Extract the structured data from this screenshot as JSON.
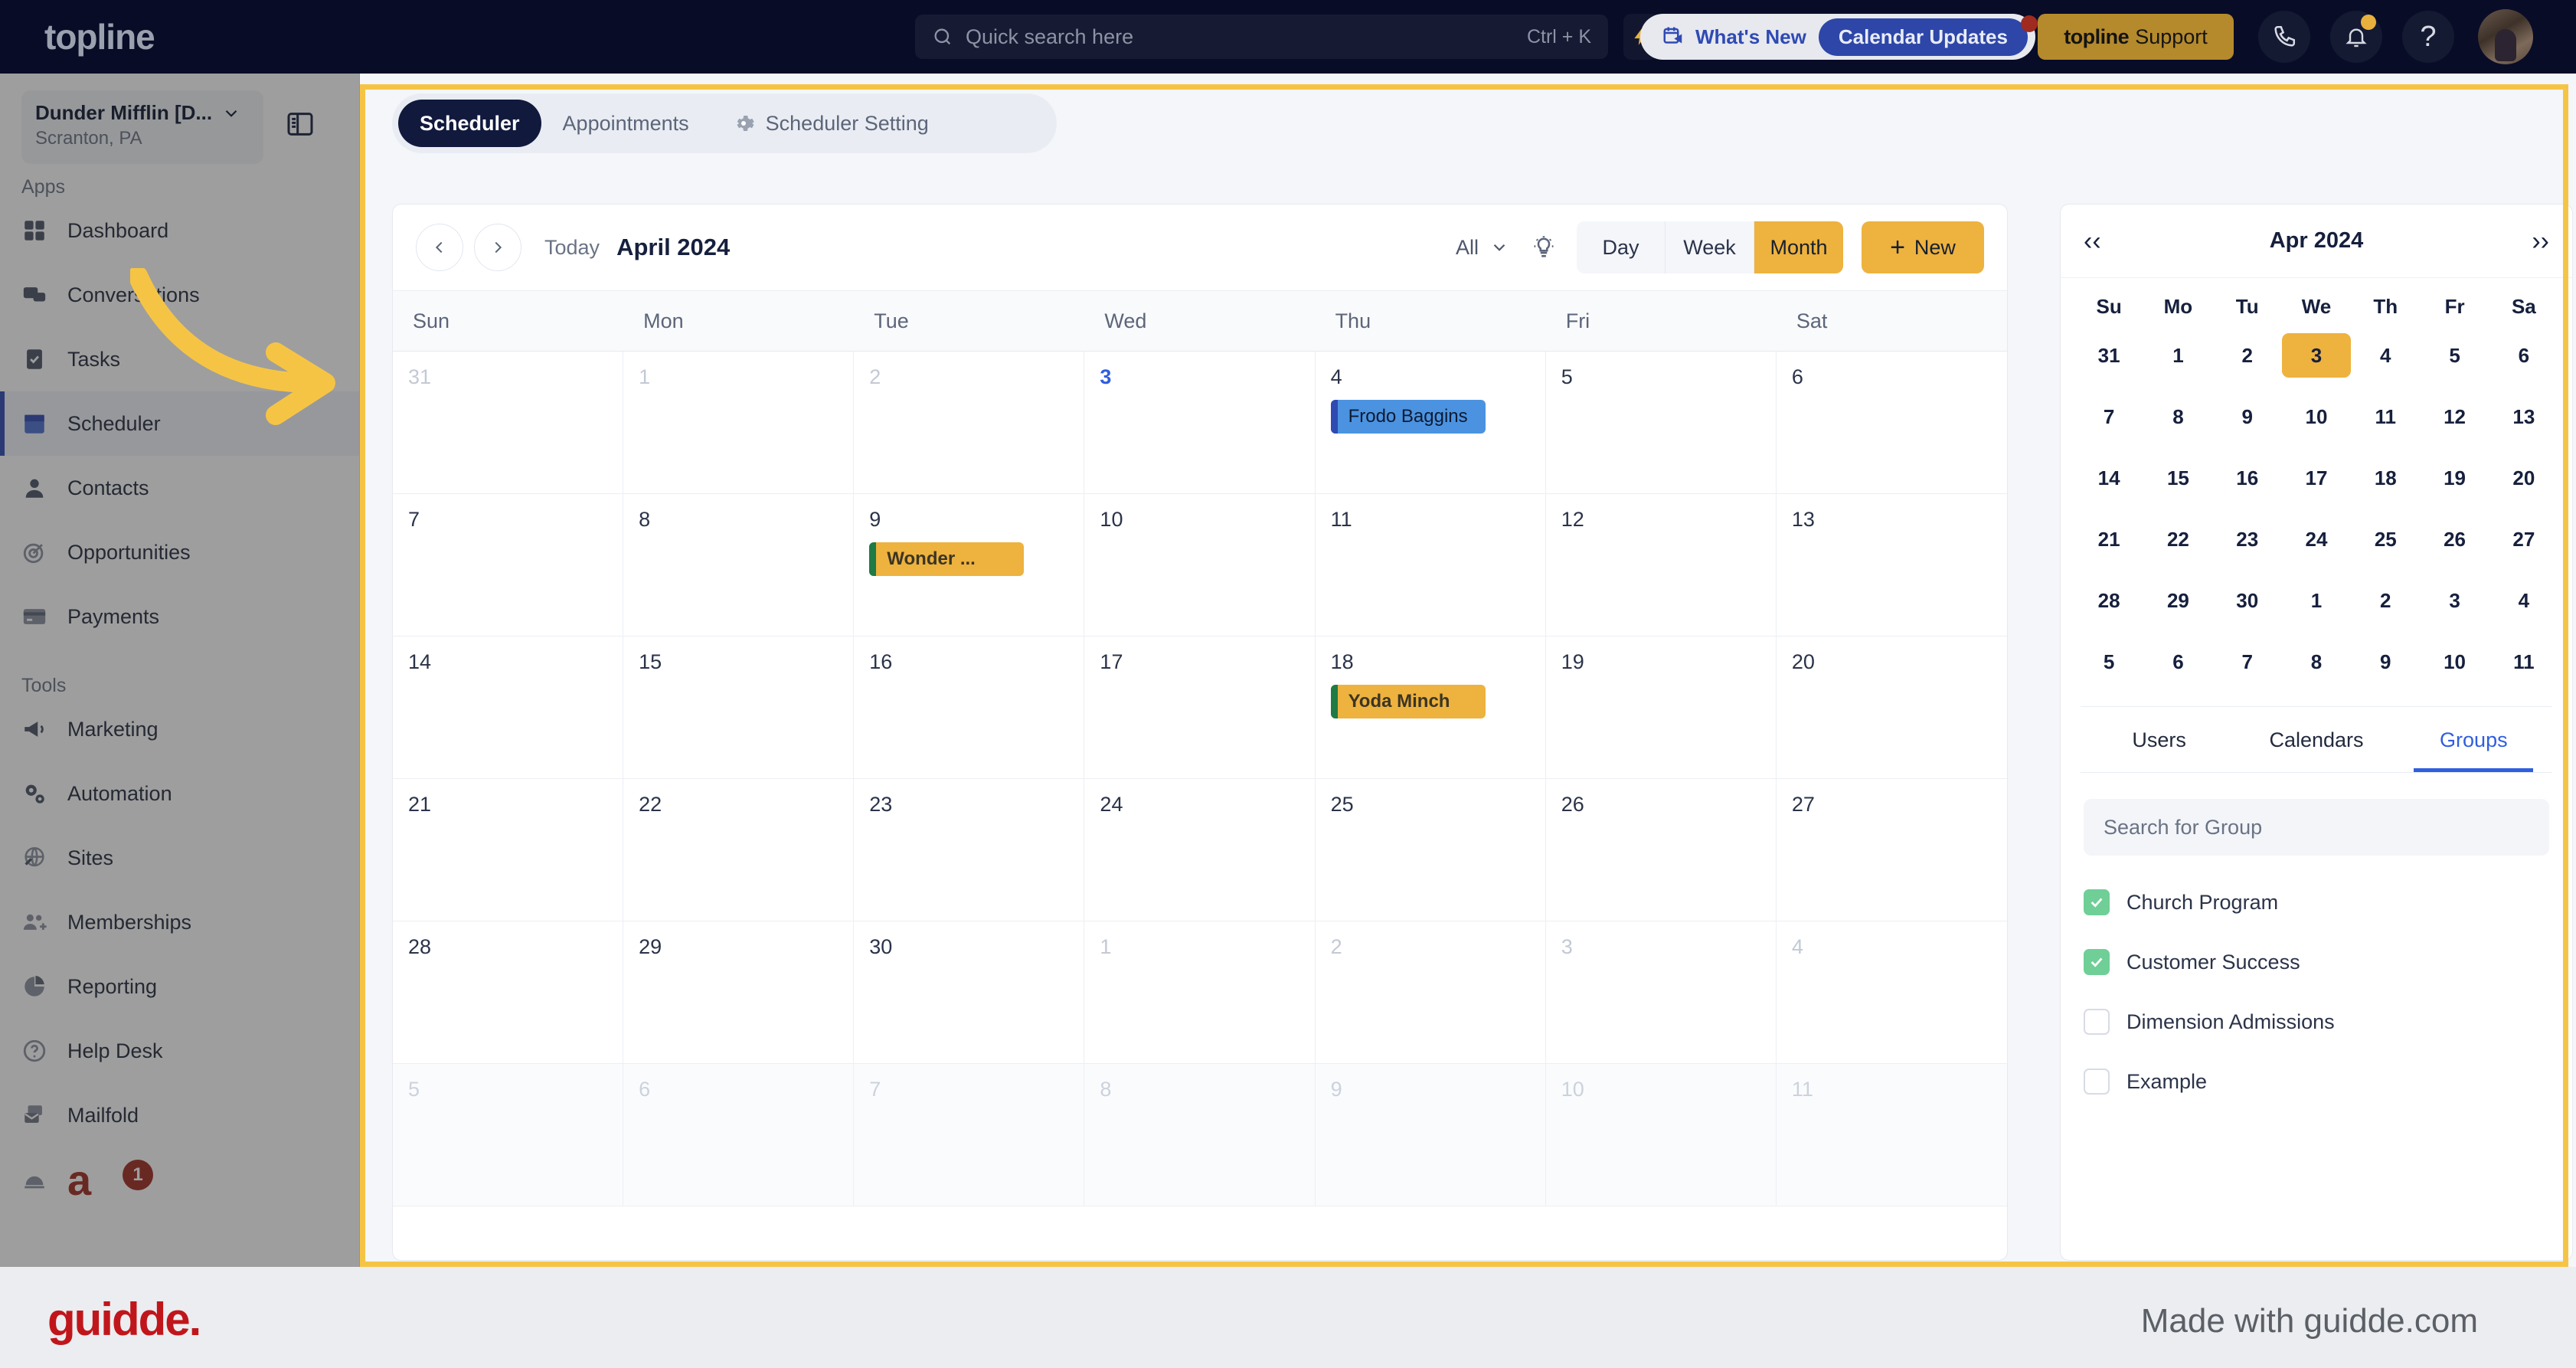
{
  "topbar": {
    "brand": "topline",
    "search": {
      "placeholder": "Quick search here",
      "shortcut": "Ctrl + K",
      "icon": "search-icon"
    },
    "lightning_icon": "lightning-icon",
    "whats_new": {
      "label": "What's New",
      "pill": "Calendar Updates",
      "icon": "calendar-megaphone-icon"
    },
    "support_button": {
      "brand": "topline",
      "label": "Support"
    },
    "icons": [
      "phone-icon",
      "bell-icon",
      "help-icon"
    ],
    "avatar": "user-avatar"
  },
  "sidebar": {
    "org": {
      "name": "Dunder Mifflin [D...",
      "location": "Scranton, PA"
    },
    "panel_toggle_icon": "panel-toggle-icon",
    "sections": [
      {
        "title": "Apps",
        "items": [
          {
            "label": "Dashboard",
            "icon": "dashboard-icon",
            "active": false
          },
          {
            "label": "Conversations",
            "icon": "chat-icon",
            "active": false
          },
          {
            "label": "Tasks",
            "icon": "tasks-icon",
            "active": false
          },
          {
            "label": "Scheduler",
            "icon": "calendar-icon",
            "active": true
          },
          {
            "label": "Contacts",
            "icon": "contacts-icon",
            "active": false
          },
          {
            "label": "Opportunities",
            "icon": "target-icon",
            "active": false
          },
          {
            "label": "Payments",
            "icon": "card-icon",
            "active": false
          }
        ]
      },
      {
        "title": "Tools",
        "items": [
          {
            "label": "Marketing",
            "icon": "megaphone-icon",
            "active": false
          },
          {
            "label": "Automation",
            "icon": "gears-icon",
            "active": false
          },
          {
            "label": "Sites",
            "icon": "globe-icon",
            "active": false
          },
          {
            "label": "Memberships",
            "icon": "members-icon",
            "active": false
          },
          {
            "label": "Reporting",
            "icon": "pie-chart-icon",
            "active": false
          },
          {
            "label": "Help Desk",
            "icon": "question-circle-icon",
            "active": false
          },
          {
            "label": "Mailfold",
            "icon": "mail-stack-icon",
            "active": false
          }
        ]
      }
    ],
    "bottom_badge": "1"
  },
  "tabs": [
    {
      "label": "Scheduler",
      "active": true,
      "icon": null
    },
    {
      "label": "Appointments",
      "active": false,
      "icon": null
    },
    {
      "label": "Scheduler Setting",
      "active": false,
      "icon": "gear-icon"
    }
  ],
  "calendar": {
    "prev_icon": "chevron-left-icon",
    "next_icon": "chevron-right-icon",
    "today_label": "Today",
    "title": "April 2024",
    "filter": {
      "value": "All",
      "icon": "chevron-down-icon"
    },
    "bulb_icon": "lightbulb-icon",
    "views": [
      {
        "label": "Day",
        "active": false
      },
      {
        "label": "Week",
        "active": false
      },
      {
        "label": "Month",
        "active": true
      }
    ],
    "new_button": {
      "plus": "+",
      "label": "New"
    },
    "day_headers": [
      "Sun",
      "Mon",
      "Tue",
      "Wed",
      "Thu",
      "Fri",
      "Sat"
    ],
    "weeks": [
      {
        "dim": false,
        "days": [
          {
            "num": "31",
            "state": "muted",
            "events": []
          },
          {
            "num": "1",
            "state": "muted",
            "events": []
          },
          {
            "num": "2",
            "state": "muted",
            "events": []
          },
          {
            "num": "3",
            "state": "today",
            "events": []
          },
          {
            "num": "4",
            "state": "normal",
            "events": [
              {
                "title": "Frodo Baggins",
                "color": "blue"
              }
            ]
          },
          {
            "num": "5",
            "state": "normal",
            "events": []
          },
          {
            "num": "6",
            "state": "normal",
            "events": []
          }
        ]
      },
      {
        "dim": false,
        "days": [
          {
            "num": "7",
            "state": "normal",
            "events": []
          },
          {
            "num": "8",
            "state": "normal",
            "events": []
          },
          {
            "num": "9",
            "state": "normal",
            "events": [
              {
                "title": "Wonder ...",
                "color": "yellow"
              }
            ]
          },
          {
            "num": "10",
            "state": "normal",
            "events": []
          },
          {
            "num": "11",
            "state": "normal",
            "events": []
          },
          {
            "num": "12",
            "state": "normal",
            "events": []
          },
          {
            "num": "13",
            "state": "normal",
            "events": []
          }
        ]
      },
      {
        "dim": false,
        "days": [
          {
            "num": "14",
            "state": "normal",
            "events": []
          },
          {
            "num": "15",
            "state": "normal",
            "events": []
          },
          {
            "num": "16",
            "state": "normal",
            "events": []
          },
          {
            "num": "17",
            "state": "normal",
            "events": []
          },
          {
            "num": "18",
            "state": "normal",
            "events": [
              {
                "title": "Yoda Minch",
                "color": "yellow"
              }
            ]
          },
          {
            "num": "19",
            "state": "normal",
            "events": []
          },
          {
            "num": "20",
            "state": "normal",
            "events": []
          }
        ]
      },
      {
        "dim": false,
        "days": [
          {
            "num": "21",
            "state": "normal",
            "events": []
          },
          {
            "num": "22",
            "state": "normal",
            "events": []
          },
          {
            "num": "23",
            "state": "normal",
            "events": []
          },
          {
            "num": "24",
            "state": "normal",
            "events": []
          },
          {
            "num": "25",
            "state": "normal",
            "events": []
          },
          {
            "num": "26",
            "state": "normal",
            "events": []
          },
          {
            "num": "27",
            "state": "normal",
            "events": []
          }
        ]
      },
      {
        "dim": false,
        "days": [
          {
            "num": "28",
            "state": "normal",
            "events": []
          },
          {
            "num": "29",
            "state": "normal",
            "events": []
          },
          {
            "num": "30",
            "state": "normal",
            "events": []
          },
          {
            "num": "1",
            "state": "muted",
            "events": []
          },
          {
            "num": "2",
            "state": "muted",
            "events": []
          },
          {
            "num": "3",
            "state": "muted",
            "events": []
          },
          {
            "num": "4",
            "state": "muted",
            "events": []
          }
        ]
      },
      {
        "dim": true,
        "days": [
          {
            "num": "5",
            "state": "muted",
            "events": []
          },
          {
            "num": "6",
            "state": "muted",
            "events": []
          },
          {
            "num": "7",
            "state": "muted",
            "events": []
          },
          {
            "num": "8",
            "state": "muted",
            "events": []
          },
          {
            "num": "9",
            "state": "muted",
            "events": []
          },
          {
            "num": "10",
            "state": "muted",
            "events": []
          },
          {
            "num": "11",
            "state": "muted",
            "events": []
          }
        ]
      }
    ]
  },
  "right_panel": {
    "mini_calendar": {
      "prev_icon": "chevron-left-double-icon",
      "next_icon": "chevron-right-double-icon",
      "title": "Apr 2024",
      "day_headers": [
        "Su",
        "Mo",
        "Tu",
        "We",
        "Th",
        "Fr",
        "Sa"
      ],
      "weeks": [
        [
          "31",
          "1",
          "2",
          "3",
          "4",
          "5",
          "6"
        ],
        [
          "7",
          "8",
          "9",
          "10",
          "11",
          "12",
          "13"
        ],
        [
          "14",
          "15",
          "16",
          "17",
          "18",
          "19",
          "20"
        ],
        [
          "21",
          "22",
          "23",
          "24",
          "25",
          "26",
          "27"
        ],
        [
          "28",
          "29",
          "30",
          "1",
          "2",
          "3",
          "4"
        ],
        [
          "5",
          "6",
          "7",
          "8",
          "9",
          "10",
          "11"
        ]
      ],
      "selected": {
        "week": 0,
        "day": 3
      }
    },
    "tabs": [
      {
        "label": "Users",
        "active": false
      },
      {
        "label": "Calendars",
        "active": false
      },
      {
        "label": "Groups",
        "active": true
      }
    ],
    "search": {
      "placeholder": "Search for Group"
    },
    "groups": [
      {
        "label": "Church Program",
        "checked": true
      },
      {
        "label": "Customer Success",
        "checked": true
      },
      {
        "label": "Dimension Admissions",
        "checked": false
      },
      {
        "label": "Example",
        "checked": false
      }
    ]
  },
  "footer": {
    "logo": "guidde.",
    "tagline": "Made with guidde.com"
  },
  "colors": {
    "accent_yellow": "#eeb23f",
    "brand_dark": "#080c27",
    "blue": "#2f5ee0",
    "green_check": "#6fcf97",
    "guidde_red": "#c0161b"
  }
}
